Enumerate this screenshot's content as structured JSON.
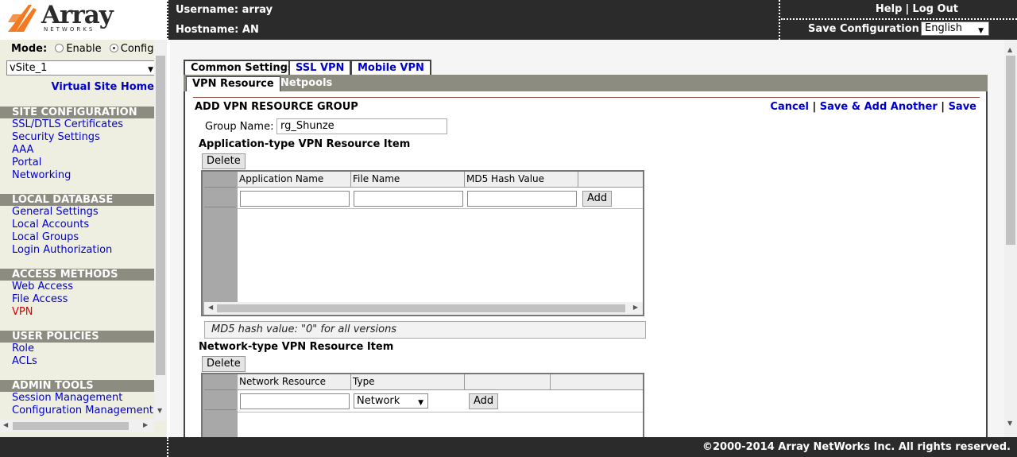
{
  "header": {
    "brand": "Array",
    "brand_sub": "NETWORKS",
    "username_label": "Username: array",
    "hostname_label": "Hostname: AN",
    "help": "Help",
    "link_sep": "|",
    "logout": "Log Out",
    "save_configuration": "Save Configuration",
    "language": "English"
  },
  "sidebar": {
    "mode_label": "Mode:",
    "mode_enable": "Enable",
    "mode_config": "Config",
    "virtual_site": "vSite_1",
    "virtual_site_home": "Virtual Site Home",
    "sections": [
      {
        "title": "SITE CONFIGURATION",
        "items": [
          "SSL/DTLS Certificates",
          "Security Settings",
          "AAA",
          "Portal",
          "Networking"
        ]
      },
      {
        "title": "LOCAL DATABASE",
        "items": [
          "General Settings",
          "Local Accounts",
          "Local Groups",
          "Login Authorization"
        ]
      },
      {
        "title": "ACCESS METHODS",
        "items": [
          "Web Access",
          "File Access",
          "VPN"
        ]
      },
      {
        "title": "USER POLICIES",
        "items": [
          "Role",
          "ACLs"
        ]
      },
      {
        "title": "ADMIN TOOLS",
        "items": [
          "Session Management",
          "Configuration Management"
        ]
      }
    ]
  },
  "tabs": [
    "Common Settings",
    "SSL VPN",
    "Mobile VPN"
  ],
  "subtabs": [
    "VPN Resource",
    "Netpools"
  ],
  "panel": {
    "title": "ADD VPN RESOURCE GROUP",
    "cancel": "Cancel",
    "separator": "|",
    "save_add_another": "Save & Add Another",
    "save": "Save",
    "group_name_label": "Group Name:",
    "group_name_value": "rg_Shunze",
    "app_section_title": "Application-type VPN Resource Item",
    "delete_label": "Delete",
    "add_label": "Add",
    "app_columns": [
      "Application Name",
      "File Name",
      "MD5 Hash Value"
    ],
    "md5_note": "MD5 hash value: \"0\" for all versions",
    "net_section_title": "Network-type VPN Resource Item",
    "net_columns": [
      "Network Resource",
      "Type"
    ],
    "net_type_value": "Network"
  },
  "footer": {
    "copyright": "©2000-2014 Array NetWorks Inc. All rights reserved."
  }
}
